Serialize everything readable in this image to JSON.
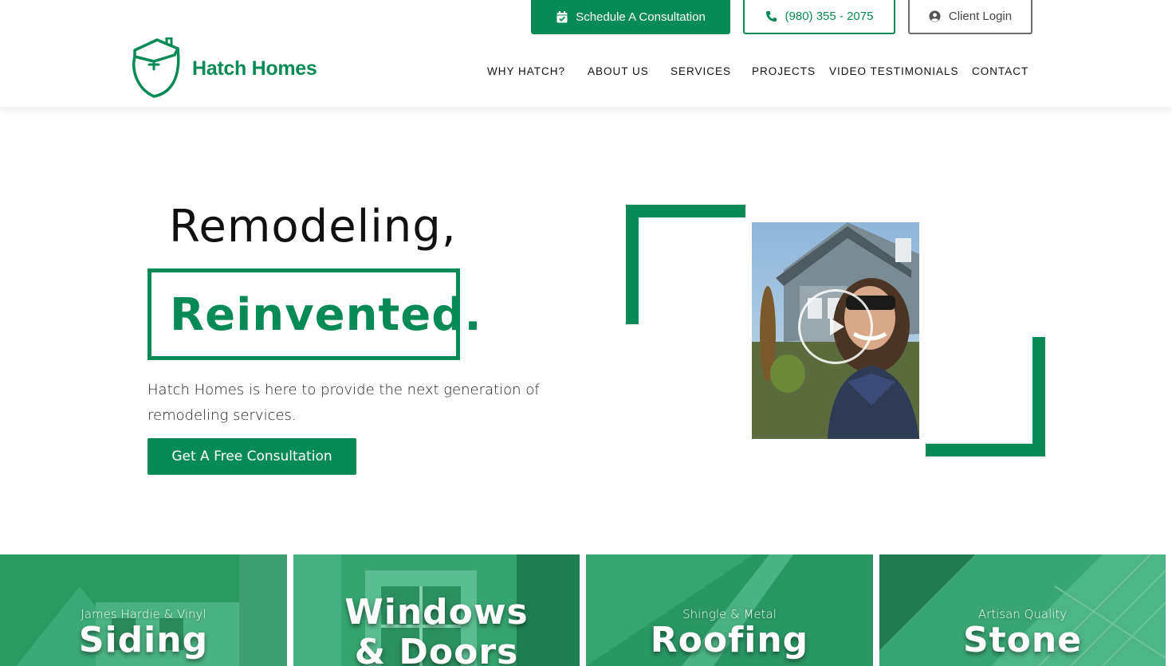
{
  "brand": {
    "name": "Hatch Homes",
    "color": "#078a55"
  },
  "top_buttons": {
    "schedule": "Schedule A Consultation",
    "phone": "(980) 355 - 2075",
    "login": "Client Login"
  },
  "nav": [
    "WHY HATCH?",
    "ABOUT US",
    "SERVICES",
    "PROJECTS",
    "VIDEO TESTIMONIALS",
    "CONTACT"
  ],
  "hero": {
    "line1": "Remodeling,",
    "line2": "Reinvented.",
    "description": "Hatch Homes is here to provide the next generation of remodeling services.",
    "cta": "Get A Free Consultation"
  },
  "video": {
    "icon": "play-icon"
  },
  "services": [
    {
      "subtitle": "James Hardie & Vinyl",
      "title": "Siding"
    },
    {
      "subtitle": "",
      "title_line1": "Windows",
      "title_line2": "& Doors"
    },
    {
      "subtitle": "Shingle & Metal",
      "title": "Roofing"
    },
    {
      "subtitle": "Artisan Quality",
      "title": "Stone"
    }
  ]
}
